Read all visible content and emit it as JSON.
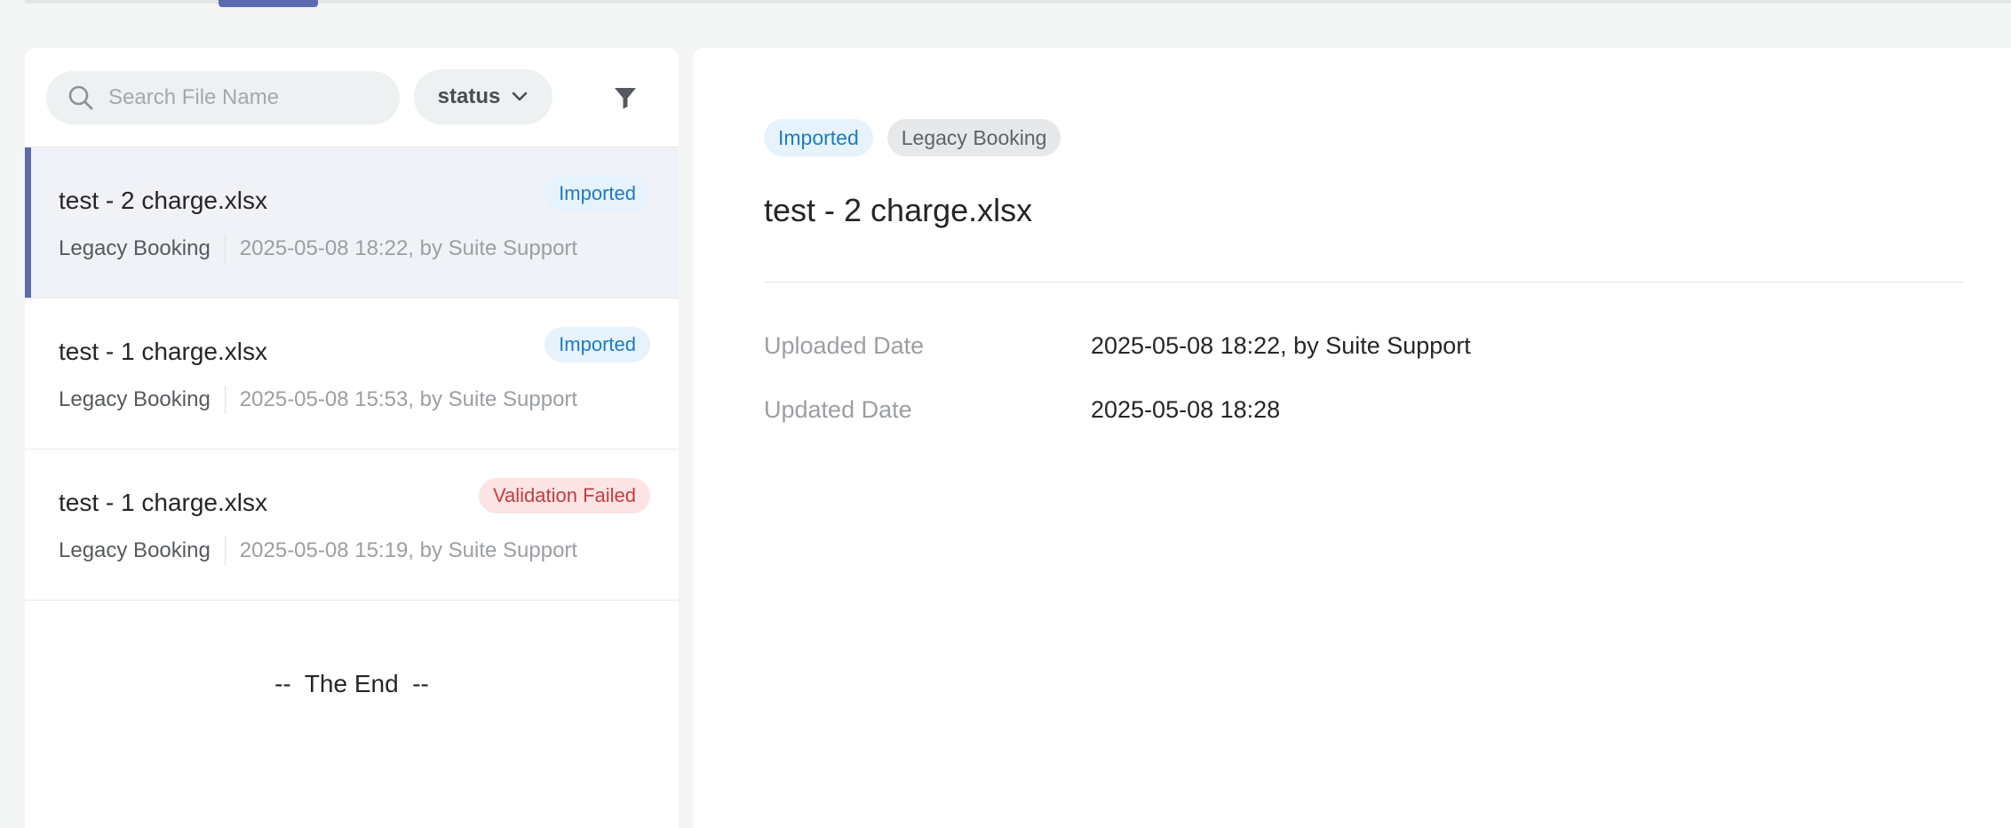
{
  "search": {
    "placeholder": "Search File Name",
    "value": ""
  },
  "status_filter": {
    "label": "status"
  },
  "icons": {
    "search": "search-icon",
    "chevron": "chevron-down-icon",
    "filter": "filter-icon"
  },
  "colors": {
    "accent": "#5a6bb0",
    "imported": "#1d7bbf",
    "failed": "#c43d3d"
  },
  "files": [
    {
      "name": "test - 2 charge.xlsx",
      "status": "Imported",
      "status_kind": "ok",
      "type": "Legacy Booking",
      "uploaded": "2025-05-08 18:22, by Suite Support",
      "selected": true
    },
    {
      "name": "test - 1 charge.xlsx",
      "status": "Imported",
      "status_kind": "ok",
      "type": "Legacy Booking",
      "uploaded": "2025-05-08 15:53, by Suite Support",
      "selected": false
    },
    {
      "name": "test - 1 charge.xlsx",
      "status": "Validation Failed",
      "status_kind": "fail",
      "type": "Legacy Booking",
      "uploaded": "2025-05-08 15:19, by Suite Support",
      "selected": false
    }
  ],
  "list_end": "--  The End  --",
  "detail": {
    "status_tag": "Imported",
    "type_tag": "Legacy Booking",
    "title": "test - 2 charge.xlsx",
    "uploaded_label": "Uploaded Date",
    "uploaded_value": "2025-05-08 18:22, by Suite Support",
    "updated_label": "Updated Date",
    "updated_value": "2025-05-08 18:28"
  }
}
